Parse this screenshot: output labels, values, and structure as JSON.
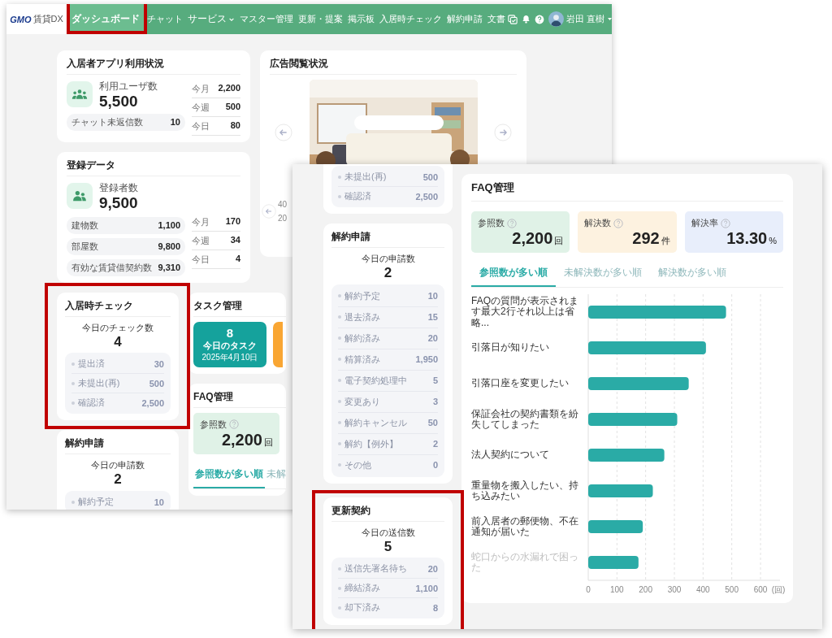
{
  "back_window": {
    "nav": {
      "logo": {
        "mark": "GMO",
        "name": "賃貸DX"
      },
      "items": [
        {
          "label": "ダッシュボード",
          "selected": true,
          "has_menu": false,
          "highlighted": true
        },
        {
          "label": "チャット",
          "selected": false,
          "has_menu": false,
          "highlighted": false
        },
        {
          "label": "サービス",
          "selected": false,
          "has_menu": true,
          "highlighted": false
        },
        {
          "label": "マスター管理",
          "selected": false,
          "has_menu": false,
          "highlighted": false
        },
        {
          "label": "更新・提案",
          "selected": false,
          "has_menu": false,
          "highlighted": false
        },
        {
          "label": "掲示板",
          "selected": false,
          "has_menu": false,
          "highlighted": false
        },
        {
          "label": "入居時チェック",
          "selected": false,
          "has_menu": false,
          "highlighted": false
        },
        {
          "label": "解約申請",
          "selected": false,
          "has_menu": false,
          "highlighted": false
        },
        {
          "label": "文書",
          "selected": false,
          "has_menu": false,
          "highlighted": false
        }
      ],
      "user": {
        "name": "岩田 直樹"
      }
    },
    "app_usage": {
      "title": "入居者アプリ利用状況",
      "users_label": "利用ユーザ数",
      "users_value": "5,500",
      "chat_label": "チャット未返信数",
      "chat_value": "10",
      "periods": [
        {
          "label": "今月",
          "value": "2,200"
        },
        {
          "label": "今週",
          "value": "500"
        },
        {
          "label": "今日",
          "value": "80"
        }
      ]
    },
    "registration": {
      "title": "登録データ",
      "registered_label": "登録者数",
      "registered_value": "9,500",
      "totals": [
        {
          "label": "建物数",
          "value": "1,100"
        },
        {
          "label": "部屋数",
          "value": "9,800"
        },
        {
          "label": "有効な賃貸借契約数",
          "value": "9,310"
        }
      ],
      "periods": [
        {
          "label": "今月",
          "value": "170"
        },
        {
          "label": "今週",
          "value": "34"
        },
        {
          "label": "今日",
          "value": "4"
        }
      ]
    },
    "ad_views": {
      "title": "広告閲覧状況",
      "banner": {
        "kind": "picture"
      },
      "axis_ticks": [
        "40",
        "20"
      ]
    },
    "move_in_check": {
      "title": "入居時チェック",
      "highlighted": true,
      "today_label": "今日のチェック数",
      "today_value": "4",
      "rows": [
        {
          "label": "提出済",
          "value": "30"
        },
        {
          "label": "未提出(再)",
          "value": "500"
        },
        {
          "label": "確認済",
          "value": "2,500"
        }
      ]
    },
    "cancellation": {
      "title": "解約申請",
      "highlighted": false,
      "today_label": "今日の申請数",
      "today_value": "2",
      "rows": [
        {
          "label": "解約予定",
          "value": "10"
        }
      ]
    },
    "tasks": {
      "title": "タスク管理",
      "tiles": [
        {
          "count": "8",
          "label": "今日のタスク",
          "date": "2025年4月10日",
          "color": "#15a29c"
        },
        {
          "color": "#f9a633"
        }
      ]
    },
    "faq": {
      "title": "FAQ管理",
      "stats": [
        {
          "label": "参照数",
          "value": "2,200",
          "unit": "回",
          "color": "#e0f2e7"
        }
      ],
      "tabs": [
        {
          "label": "参照数が多い順",
          "selected": true
        },
        {
          "label": "未解",
          "selected": false
        }
      ]
    }
  },
  "front_window": {
    "status_card": {
      "rows": [
        {
          "label": "未提出(再)",
          "value": "500"
        },
        {
          "label": "確認済",
          "value": "2,500"
        }
      ]
    },
    "cancellation": {
      "title": "解約申請",
      "highlighted": false,
      "today_label": "今日の申請数",
      "today_value": "2",
      "rows": [
        {
          "label": "解約予定",
          "value": "10"
        },
        {
          "label": "退去済み",
          "value": "15"
        },
        {
          "label": "解約済み",
          "value": "20"
        },
        {
          "label": "精算済み",
          "value": "1,950"
        },
        {
          "label": "電子契約処理中",
          "value": "5"
        },
        {
          "label": "変更あり",
          "value": "3"
        },
        {
          "label": "解約キャンセル",
          "value": "50"
        },
        {
          "label": "解約【例外】",
          "value": "2"
        },
        {
          "label": "その他",
          "value": "0"
        }
      ]
    },
    "renewal": {
      "title": "更新契約",
      "highlighted": true,
      "today_label": "今日の送信数",
      "today_value": "5",
      "rows": [
        {
          "label": "送信先署名待ち",
          "value": "20"
        },
        {
          "label": "締結済み",
          "value": "1,100"
        },
        {
          "label": "却下済み",
          "value": "8"
        }
      ]
    },
    "faq": {
      "title": "FAQ管理",
      "stats": [
        {
          "label": "参照数",
          "value": "2,200",
          "unit": "回",
          "color": "#e0f2e7"
        },
        {
          "label": "解決数",
          "value": "292",
          "unit": "件",
          "color": "#fdf2e0"
        },
        {
          "label": "解決率",
          "value": "13.30",
          "unit": "%",
          "color": "#e8eefb"
        }
      ],
      "tabs": [
        {
          "label": "参照数が多い順",
          "selected": true
        },
        {
          "label": "未解決数が多い順",
          "selected": false
        },
        {
          "label": "解決数が多い順",
          "selected": false
        }
      ],
      "chart_data": {
        "type": "bar",
        "orientation": "horizontal",
        "xlabel": "(回)",
        "categories": [
          "FAQの質問が表示されます最大2行それ以上は省略...",
          "引落日が知りたい",
          "引落口座を変更したい",
          "保証会社の契約書類を紛失してしまった",
          "法人契約について",
          "重量物を搬入したい、持ち込みたい",
          "前入居者の郵便物、不在通知が届いた",
          "蛇口からの水漏れで困った"
        ],
        "values": [
          480,
          410,
          350,
          310,
          265,
          225,
          190,
          175
        ],
        "xlim": [
          0,
          600
        ],
        "xticks": [
          0,
          100,
          200,
          300,
          400,
          500,
          600
        ],
        "grid": true
      }
    }
  }
}
